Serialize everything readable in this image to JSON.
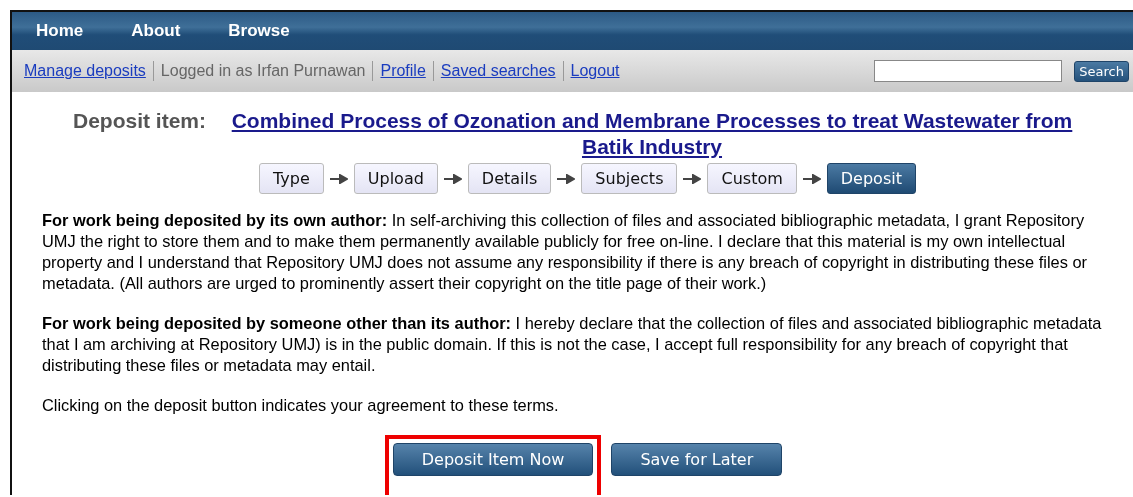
{
  "nav": [
    "Home",
    "About",
    "Browse"
  ],
  "user_bar": {
    "links": [
      {
        "kind": "link",
        "text": "Manage deposits"
      },
      {
        "kind": "text",
        "text": "Logged in as Irfan Purnawan"
      },
      {
        "kind": "link",
        "text": "Profile"
      },
      {
        "kind": "link",
        "text": "Saved searches"
      },
      {
        "kind": "link",
        "text": "Logout"
      }
    ],
    "search_button": "Search"
  },
  "heading": {
    "label": "Deposit item:",
    "title": "Combined Process of Ozonation and Membrane Processes to treat Wastewater from Batik Industry"
  },
  "steps": [
    {
      "label": "Type",
      "selected": false
    },
    {
      "label": "Upload",
      "selected": false
    },
    {
      "label": "Details",
      "selected": false
    },
    {
      "label": "Subjects",
      "selected": false
    },
    {
      "label": "Custom",
      "selected": false
    },
    {
      "label": "Deposit",
      "selected": true
    }
  ],
  "terms": [
    "**For work being deposited by its own author:** In self-archiving this collection of files and associated bibliographic metadata, I grant Repository UMJ the right to store them and to make them permanently available publicly for free on-line. I declare that this material is my own intellectual property and I understand that Repository UMJ does not assume any responsibility if there is any breach of copyright in distributing these files or metadata. (All authors are urged to prominently assert their copyright on the title page of their work.)",
    "**For work being deposited by someone other than its author:** I hereby declare that the collection of files and associated bibliographic metadata that I am archiving at Repository UMJ) is in the public domain. If this is not the case, I accept full responsibility for any breach of copyright that distributing these files or metadata may entail.",
    "Clicking on the deposit button indicates your agreement to these terms."
  ],
  "buttons": [
    {
      "label": "Deposit Item Now",
      "highlighted": true
    },
    {
      "label": "Save for Later",
      "highlighted": false
    }
  ]
}
